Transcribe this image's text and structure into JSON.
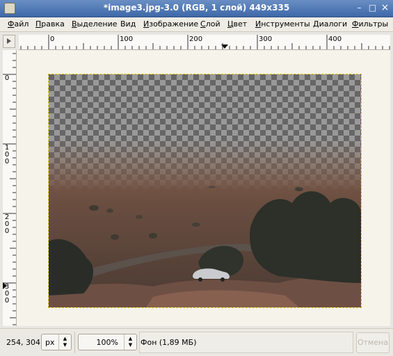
{
  "window": {
    "title": "*image3.jpg-3.0 (RGB, 1 слой) 449x335",
    "minimize": "–",
    "maximize": "□",
    "close": "×"
  },
  "menubar": {
    "items": [
      {
        "label": "Файл",
        "underline": "Ф",
        "rest": "айл"
      },
      {
        "label": "Правка",
        "underline": "П",
        "rest": "равка"
      },
      {
        "label": "Выделение",
        "underline": "В",
        "rest": "ыделение"
      },
      {
        "label": "Вид",
        "underline": "",
        "rest": "Вид"
      },
      {
        "label": "Изображение",
        "underline": "И",
        "rest": "зображение"
      },
      {
        "label": "Слой",
        "underline": "С",
        "rest": "лой"
      },
      {
        "label": "Цвет",
        "underline": "Ц",
        "rest": "вет"
      },
      {
        "label": "Инструменты",
        "underline": "И",
        "rest": "нструменты"
      },
      {
        "label": "Диалоги",
        "underline": "Д",
        "rest": "иалоги"
      },
      {
        "label": "Фильтры",
        "underline": "Ф",
        "rest": "ильтры"
      }
    ]
  },
  "rulers": {
    "horizontal": [
      "0",
      "100",
      "200",
      "300",
      "400"
    ],
    "vertical": [
      [
        "0"
      ],
      [
        "1",
        "0",
        "0"
      ],
      [
        "2",
        "0",
        "0"
      ],
      [
        "3",
        "0",
        "0"
      ]
    ]
  },
  "statusbar": {
    "coords": "254, 304",
    "unit": "px",
    "zoom": "100%",
    "layer": "Фон (1,89 МБ)",
    "cancel": "Отмена"
  },
  "colors": {
    "titlebar": "#4a74b4",
    "selection": "#d8c200",
    "canvas_bg": "#f6f3ea"
  }
}
